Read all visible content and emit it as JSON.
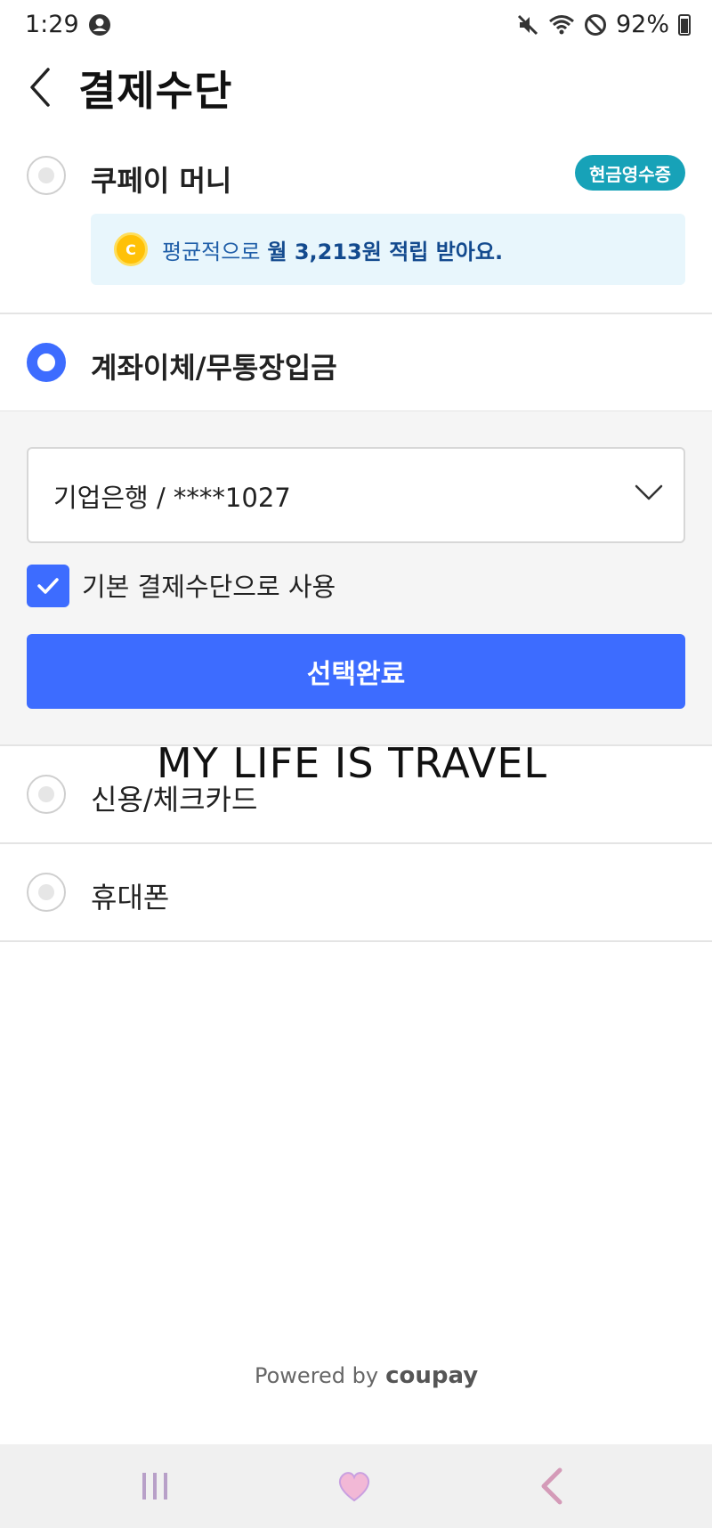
{
  "status": {
    "time": "1:29",
    "battery": "92%",
    "icons": [
      "account-circle-icon",
      "mute-icon",
      "wifi-icon",
      "do-not-disturb-icon",
      "battery-icon"
    ]
  },
  "header": {
    "title": "결제수단",
    "back_icon": "chevron-left-icon"
  },
  "options": {
    "coupay_money": {
      "label": "쿠페이 머니",
      "badge": "현금영수증",
      "info_prefix": "평균적으로",
      "info_strong": "월 3,213원 적립 받아요.",
      "coin_glyph": "C"
    },
    "bank_transfer": {
      "label": "계좌이체/무통장입금",
      "selected_account": "기업은행 / ****1027",
      "default_checkbox_label": "기본 결제수단으로 사용",
      "default_checked": true,
      "confirm_button": "선택완료"
    },
    "card": {
      "label": "신용/체크카드"
    },
    "phone": {
      "label": "휴대폰"
    }
  },
  "watermark": "MY LIFE IS TRAVEL",
  "footer": {
    "powered_by": "Powered by",
    "brand": "coupay"
  },
  "colors": {
    "accent": "#3d6cff",
    "badge": "#17a2b8",
    "info_bg": "#e8f6fc"
  }
}
